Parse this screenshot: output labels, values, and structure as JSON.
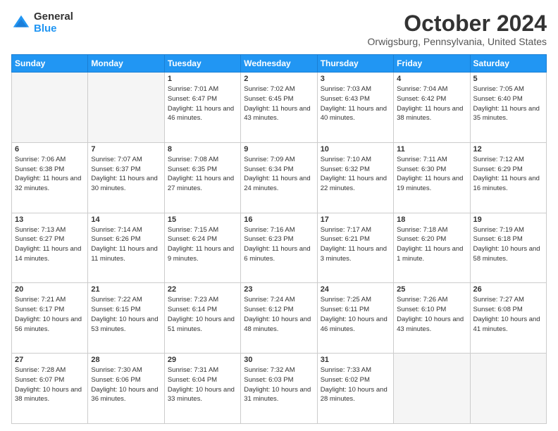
{
  "header": {
    "logo_general": "General",
    "logo_blue": "Blue",
    "month_title": "October 2024",
    "location": "Orwigsburg, Pennsylvania, United States"
  },
  "days_of_week": [
    "Sunday",
    "Monday",
    "Tuesday",
    "Wednesday",
    "Thursday",
    "Friday",
    "Saturday"
  ],
  "weeks": [
    [
      {
        "day": "",
        "empty": true
      },
      {
        "day": "",
        "empty": true
      },
      {
        "day": "1",
        "sunrise": "7:01 AM",
        "sunset": "6:47 PM",
        "daylight": "11 hours and 46 minutes."
      },
      {
        "day": "2",
        "sunrise": "7:02 AM",
        "sunset": "6:45 PM",
        "daylight": "11 hours and 43 minutes."
      },
      {
        "day": "3",
        "sunrise": "7:03 AM",
        "sunset": "6:43 PM",
        "daylight": "11 hours and 40 minutes."
      },
      {
        "day": "4",
        "sunrise": "7:04 AM",
        "sunset": "6:42 PM",
        "daylight": "11 hours and 38 minutes."
      },
      {
        "day": "5",
        "sunrise": "7:05 AM",
        "sunset": "6:40 PM",
        "daylight": "11 hours and 35 minutes."
      }
    ],
    [
      {
        "day": "6",
        "sunrise": "7:06 AM",
        "sunset": "6:38 PM",
        "daylight": "11 hours and 32 minutes."
      },
      {
        "day": "7",
        "sunrise": "7:07 AM",
        "sunset": "6:37 PM",
        "daylight": "11 hours and 30 minutes."
      },
      {
        "day": "8",
        "sunrise": "7:08 AM",
        "sunset": "6:35 PM",
        "daylight": "11 hours and 27 minutes."
      },
      {
        "day": "9",
        "sunrise": "7:09 AM",
        "sunset": "6:34 PM",
        "daylight": "11 hours and 24 minutes."
      },
      {
        "day": "10",
        "sunrise": "7:10 AM",
        "sunset": "6:32 PM",
        "daylight": "11 hours and 22 minutes."
      },
      {
        "day": "11",
        "sunrise": "7:11 AM",
        "sunset": "6:30 PM",
        "daylight": "11 hours and 19 minutes."
      },
      {
        "day": "12",
        "sunrise": "7:12 AM",
        "sunset": "6:29 PM",
        "daylight": "11 hours and 16 minutes."
      }
    ],
    [
      {
        "day": "13",
        "sunrise": "7:13 AM",
        "sunset": "6:27 PM",
        "daylight": "11 hours and 14 minutes."
      },
      {
        "day": "14",
        "sunrise": "7:14 AM",
        "sunset": "6:26 PM",
        "daylight": "11 hours and 11 minutes."
      },
      {
        "day": "15",
        "sunrise": "7:15 AM",
        "sunset": "6:24 PM",
        "daylight": "11 hours and 9 minutes."
      },
      {
        "day": "16",
        "sunrise": "7:16 AM",
        "sunset": "6:23 PM",
        "daylight": "11 hours and 6 minutes."
      },
      {
        "day": "17",
        "sunrise": "7:17 AM",
        "sunset": "6:21 PM",
        "daylight": "11 hours and 3 minutes."
      },
      {
        "day": "18",
        "sunrise": "7:18 AM",
        "sunset": "6:20 PM",
        "daylight": "11 hours and 1 minute."
      },
      {
        "day": "19",
        "sunrise": "7:19 AM",
        "sunset": "6:18 PM",
        "daylight": "10 hours and 58 minutes."
      }
    ],
    [
      {
        "day": "20",
        "sunrise": "7:21 AM",
        "sunset": "6:17 PM",
        "daylight": "10 hours and 56 minutes."
      },
      {
        "day": "21",
        "sunrise": "7:22 AM",
        "sunset": "6:15 PM",
        "daylight": "10 hours and 53 minutes."
      },
      {
        "day": "22",
        "sunrise": "7:23 AM",
        "sunset": "6:14 PM",
        "daylight": "10 hours and 51 minutes."
      },
      {
        "day": "23",
        "sunrise": "7:24 AM",
        "sunset": "6:12 PM",
        "daylight": "10 hours and 48 minutes."
      },
      {
        "day": "24",
        "sunrise": "7:25 AM",
        "sunset": "6:11 PM",
        "daylight": "10 hours and 46 minutes."
      },
      {
        "day": "25",
        "sunrise": "7:26 AM",
        "sunset": "6:10 PM",
        "daylight": "10 hours and 43 minutes."
      },
      {
        "day": "26",
        "sunrise": "7:27 AM",
        "sunset": "6:08 PM",
        "daylight": "10 hours and 41 minutes."
      }
    ],
    [
      {
        "day": "27",
        "sunrise": "7:28 AM",
        "sunset": "6:07 PM",
        "daylight": "10 hours and 38 minutes."
      },
      {
        "day": "28",
        "sunrise": "7:30 AM",
        "sunset": "6:06 PM",
        "daylight": "10 hours and 36 minutes."
      },
      {
        "day": "29",
        "sunrise": "7:31 AM",
        "sunset": "6:04 PM",
        "daylight": "10 hours and 33 minutes."
      },
      {
        "day": "30",
        "sunrise": "7:32 AM",
        "sunset": "6:03 PM",
        "daylight": "10 hours and 31 minutes."
      },
      {
        "day": "31",
        "sunrise": "7:33 AM",
        "sunset": "6:02 PM",
        "daylight": "10 hours and 28 minutes."
      },
      {
        "day": "",
        "empty": true
      },
      {
        "day": "",
        "empty": true
      }
    ]
  ]
}
